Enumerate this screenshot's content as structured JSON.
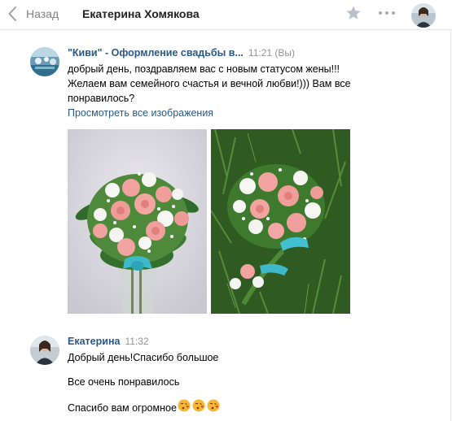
{
  "header": {
    "back_label": "Назад",
    "title": "Екатерина Хомякова",
    "back_icon": "chevron-left-icon",
    "star_icon": "star-icon",
    "more_icon": "more-dots-icon"
  },
  "messages": [
    {
      "author": "\"Киви\" - Оформление свадьбы в...",
      "time": "11:21 (Вы)",
      "lines": [
        "добрый день, поздравляем вас с новым статусом жены!!!",
        "Желаем вам семейного счастья и вечной любви!))) Вам все",
        "понравилось?"
      ],
      "link": "Просмотреть все изображения"
    },
    {
      "author": "Екатерина",
      "time": "11:32",
      "lines": [
        "Добрый день!Спасибо большое",
        "Все очень понравилось",
        "Спасибо вам огромное"
      ],
      "emoji": "face-blowing-kiss-icon"
    }
  ],
  "colors": {
    "link": "#2a5885",
    "muted": "#939393",
    "divider": "#e7e8ec"
  }
}
